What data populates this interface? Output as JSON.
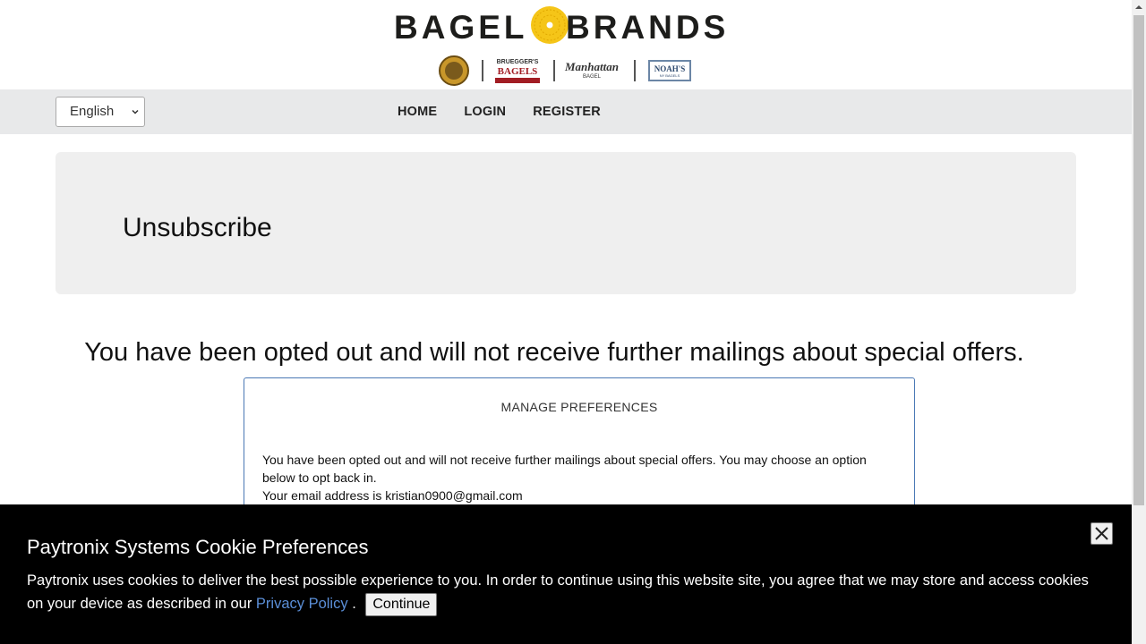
{
  "header": {
    "brand_left": "BAGEL",
    "brand_right": "BRANDS",
    "sub_brands": {
      "brueggers_top": "BRUEGGER'S",
      "brueggers_main": "BAGELS",
      "manhattan_main": "Manhattan",
      "manhattan_sub": "BAGEL",
      "noahs_main": "NOAH'S",
      "noahs_sub": "NY BAGELS"
    }
  },
  "nav": {
    "language_selected": "English",
    "links": [
      "HOME",
      "LOGIN",
      "REGISTER"
    ]
  },
  "jumbotron": {
    "title": "Unsubscribe"
  },
  "main": {
    "message": "You have been opted out and will not receive further mailings about special offers."
  },
  "preferences": {
    "title": "MANAGE PREFERENCES",
    "text": "You have been opted out and will not receive further mailings about special offers. You may choose an option below to opt back in.",
    "email_line": "Your email address is kristian0900@gmail.com"
  },
  "cookie_banner": {
    "title": "Paytronix Systems Cookie Preferences",
    "text": "Paytronix uses cookies to deliver the best possible experience to you. In order to continue using this website site, you agree that we may store and access cookies on your device as described in our",
    "link": "Privacy Policy",
    "after_link": " .",
    "continue_label": "Continue"
  },
  "colors": {
    "navbar_bg": "#e8e9ea",
    "jumbo_bg": "#efefef",
    "box_border": "#4a78b5",
    "cookie_bg": "#000000",
    "link": "#5b8fd8",
    "sun": "#f5c518"
  }
}
